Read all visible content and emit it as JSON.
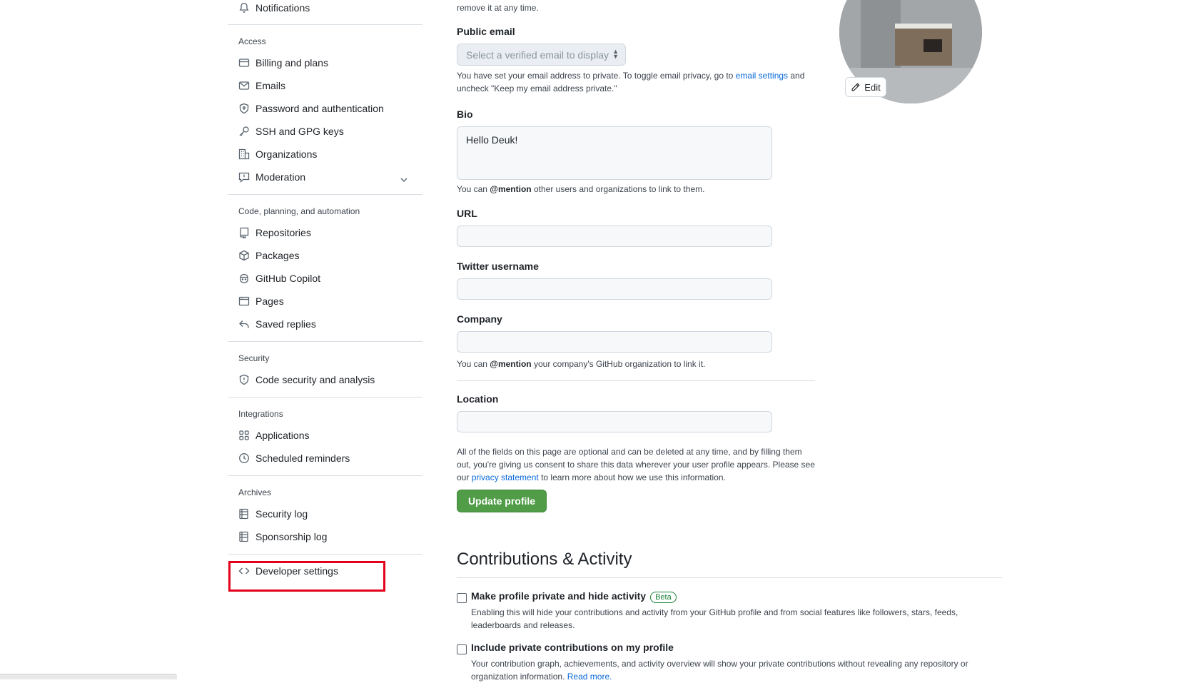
{
  "sidebar": {
    "top_item": "Notifications",
    "sections": {
      "access": "Access",
      "code": "Code, planning, and automation",
      "security": "Security",
      "integrations": "Integrations",
      "archives": "Archives"
    },
    "items": {
      "billing": "Billing and plans",
      "emails": "Emails",
      "password": "Password and authentication",
      "ssh": "SSH and GPG keys",
      "organizations": "Organizations",
      "moderation": "Moderation",
      "repositories": "Repositories",
      "packages": "Packages",
      "copilot": "GitHub Copilot",
      "pages": "Pages",
      "saved_replies": "Saved replies",
      "code_security": "Code security and analysis",
      "applications": "Applications",
      "scheduled_reminders": "Scheduled reminders",
      "security_log": "Security log",
      "sponsorship_log": "Sponsorship log",
      "developer_settings": "Developer settings"
    }
  },
  "form": {
    "top_note": "remove it at any time.",
    "public_email": {
      "label": "Public email",
      "placeholder": "Select a verified email to display",
      "note_before": "You have set your email address to private. To toggle email privacy, go to ",
      "note_link": "email settings",
      "note_after": " and",
      "note_line2": "uncheck \"Keep my email address private.\""
    },
    "bio": {
      "label": "Bio",
      "value": "Hello Deuk!",
      "note_before": "You can ",
      "note_mention": "@mention",
      "note_after": " other users and organizations to link to them."
    },
    "url": {
      "label": "URL",
      "value": ""
    },
    "twitter": {
      "label": "Twitter username",
      "value": ""
    },
    "company": {
      "label": "Company",
      "value": "",
      "note_before": "You can ",
      "note_mention": "@mention",
      "note_after": " your company's GitHub organization to link it."
    },
    "location": {
      "label": "Location",
      "value": ""
    },
    "disclaimer": {
      "line1": "All of the fields on this page are optional and can be deleted at any time, and by filling them",
      "line2": "out, you're giving us consent to share this data wherever your user profile appears. Please see",
      "line3_before": "our ",
      "line3_link": "privacy statement",
      "line3_after": " to learn more about how we use this information."
    },
    "update_button": "Update profile"
  },
  "contributions": {
    "heading": "Contributions & Activity",
    "private": {
      "label": "Make profile private and hide activity",
      "badge": "Beta",
      "desc1": "Enabling this will hide your contributions and activity from your GitHub profile and from social features like followers, stars, feeds,",
      "desc2": "leaderboards and releases.",
      "checked": false
    },
    "include_private": {
      "label": "Include private contributions on my profile",
      "desc1": "Your contribution graph, achievements, and activity overview will show your private contributions without revealing any repository or",
      "desc2_before": "organization information. ",
      "desc2_link": "Read more.",
      "checked": false
    }
  },
  "avatar": {
    "edit_label": "Edit"
  },
  "colors": {
    "primary_button": "#509c47",
    "link": "#0969da",
    "highlight": "#e3001b"
  }
}
